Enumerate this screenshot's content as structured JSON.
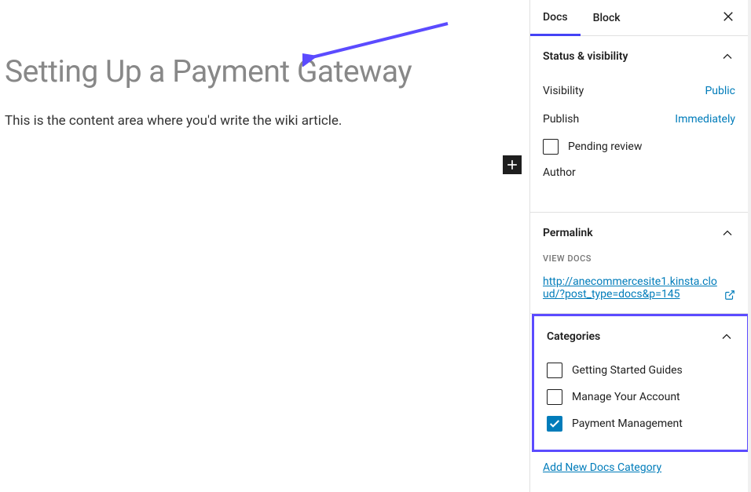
{
  "editor": {
    "title": "Setting Up a Payment Gateway",
    "content": "This is the content area where you'd write the wiki article."
  },
  "sidebar": {
    "tabs": {
      "docs": "Docs",
      "block": "Block"
    },
    "status_visibility": {
      "title": "Status & visibility",
      "visibility_label": "Visibility",
      "visibility_value": "Public",
      "publish_label": "Publish",
      "publish_value": "Immediately",
      "pending_review_label": "Pending review",
      "author_label": "Author"
    },
    "permalink": {
      "title": "Permalink",
      "view_docs_label": "VIEW DOCS",
      "url": "http://anecommercesite1.kinsta.cloud/?post_type=docs&p=145"
    },
    "categories": {
      "title": "Categories",
      "items": [
        {
          "label": "Getting Started Guides",
          "checked": false
        },
        {
          "label": "Manage Your Account",
          "checked": false
        },
        {
          "label": "Payment Management",
          "checked": true
        }
      ],
      "add_new_label": "Add New Docs Category"
    }
  }
}
